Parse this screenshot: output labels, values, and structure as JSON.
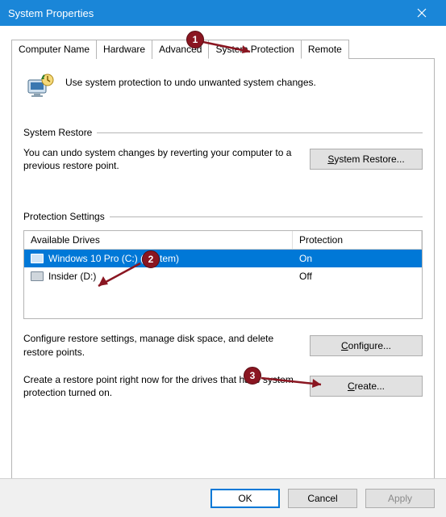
{
  "window": {
    "title": "System Properties"
  },
  "tabs": {
    "computer_name": "Computer Name",
    "hardware": "Hardware",
    "advanced": "Advanced",
    "system_protection": "System Protection",
    "remote": "Remote"
  },
  "intro_text": "Use system protection to undo unwanted system changes.",
  "system_restore": {
    "group_label": "System Restore",
    "text": "You can undo system changes by reverting your computer to a previous restore point.",
    "button_prefix": "S",
    "button_rest": "ystem Restore..."
  },
  "protection_settings": {
    "group_label": "Protection Settings",
    "header_drives": "Available Drives",
    "header_protection": "Protection",
    "drives": [
      {
        "name": "Windows 10 Pro (C:) (System)",
        "protection": "On",
        "selected": true
      },
      {
        "name": "Insider (D:)",
        "protection": "Off",
        "selected": false
      }
    ],
    "configure_text": "Configure restore settings, manage disk space, and delete restore points.",
    "configure_prefix": "C",
    "configure_rest": "onfigure...",
    "create_text": "Create a restore point right now for the drives that have system protection turned on.",
    "create_prefix": "C",
    "create_rest": "reate..."
  },
  "buttons": {
    "ok": "OK",
    "cancel": "Cancel",
    "apply": "Apply"
  },
  "annotations": {
    "b1": "1",
    "b2": "2",
    "b3": "3"
  }
}
